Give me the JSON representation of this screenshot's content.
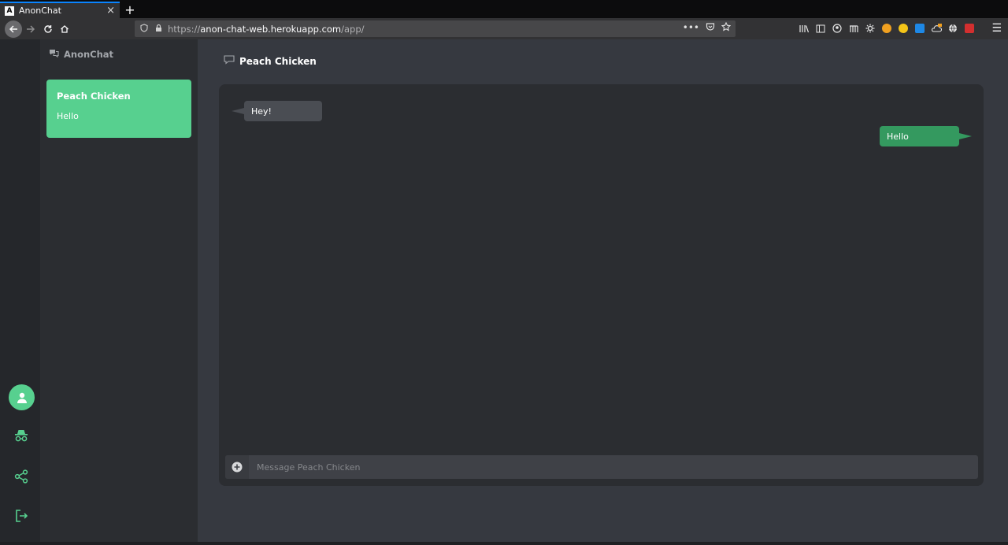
{
  "browser": {
    "tab_favicon": "A",
    "tab_title": "AnonChat",
    "tab_close": "×",
    "new_tab": "+",
    "url_prefix": "https://",
    "url_host": "anon-chat-web.herokuapp.com",
    "url_path": "/app/",
    "menu": "☰"
  },
  "app": {
    "brand": "AnonChat",
    "conversations": [
      {
        "name": "Peach Chicken",
        "last_message": "Hello"
      }
    ],
    "chat": {
      "title": "Peach Chicken",
      "messages": [
        {
          "direction": "in",
          "text": "Hey!"
        },
        {
          "direction": "out",
          "text": "Hello"
        }
      ],
      "composer_placeholder": "Message Peach Chicken"
    }
  },
  "colors": {
    "accent": "#57d08f",
    "outgoing_bubble": "#34995f",
    "incoming_bubble": "#4a4d53"
  }
}
